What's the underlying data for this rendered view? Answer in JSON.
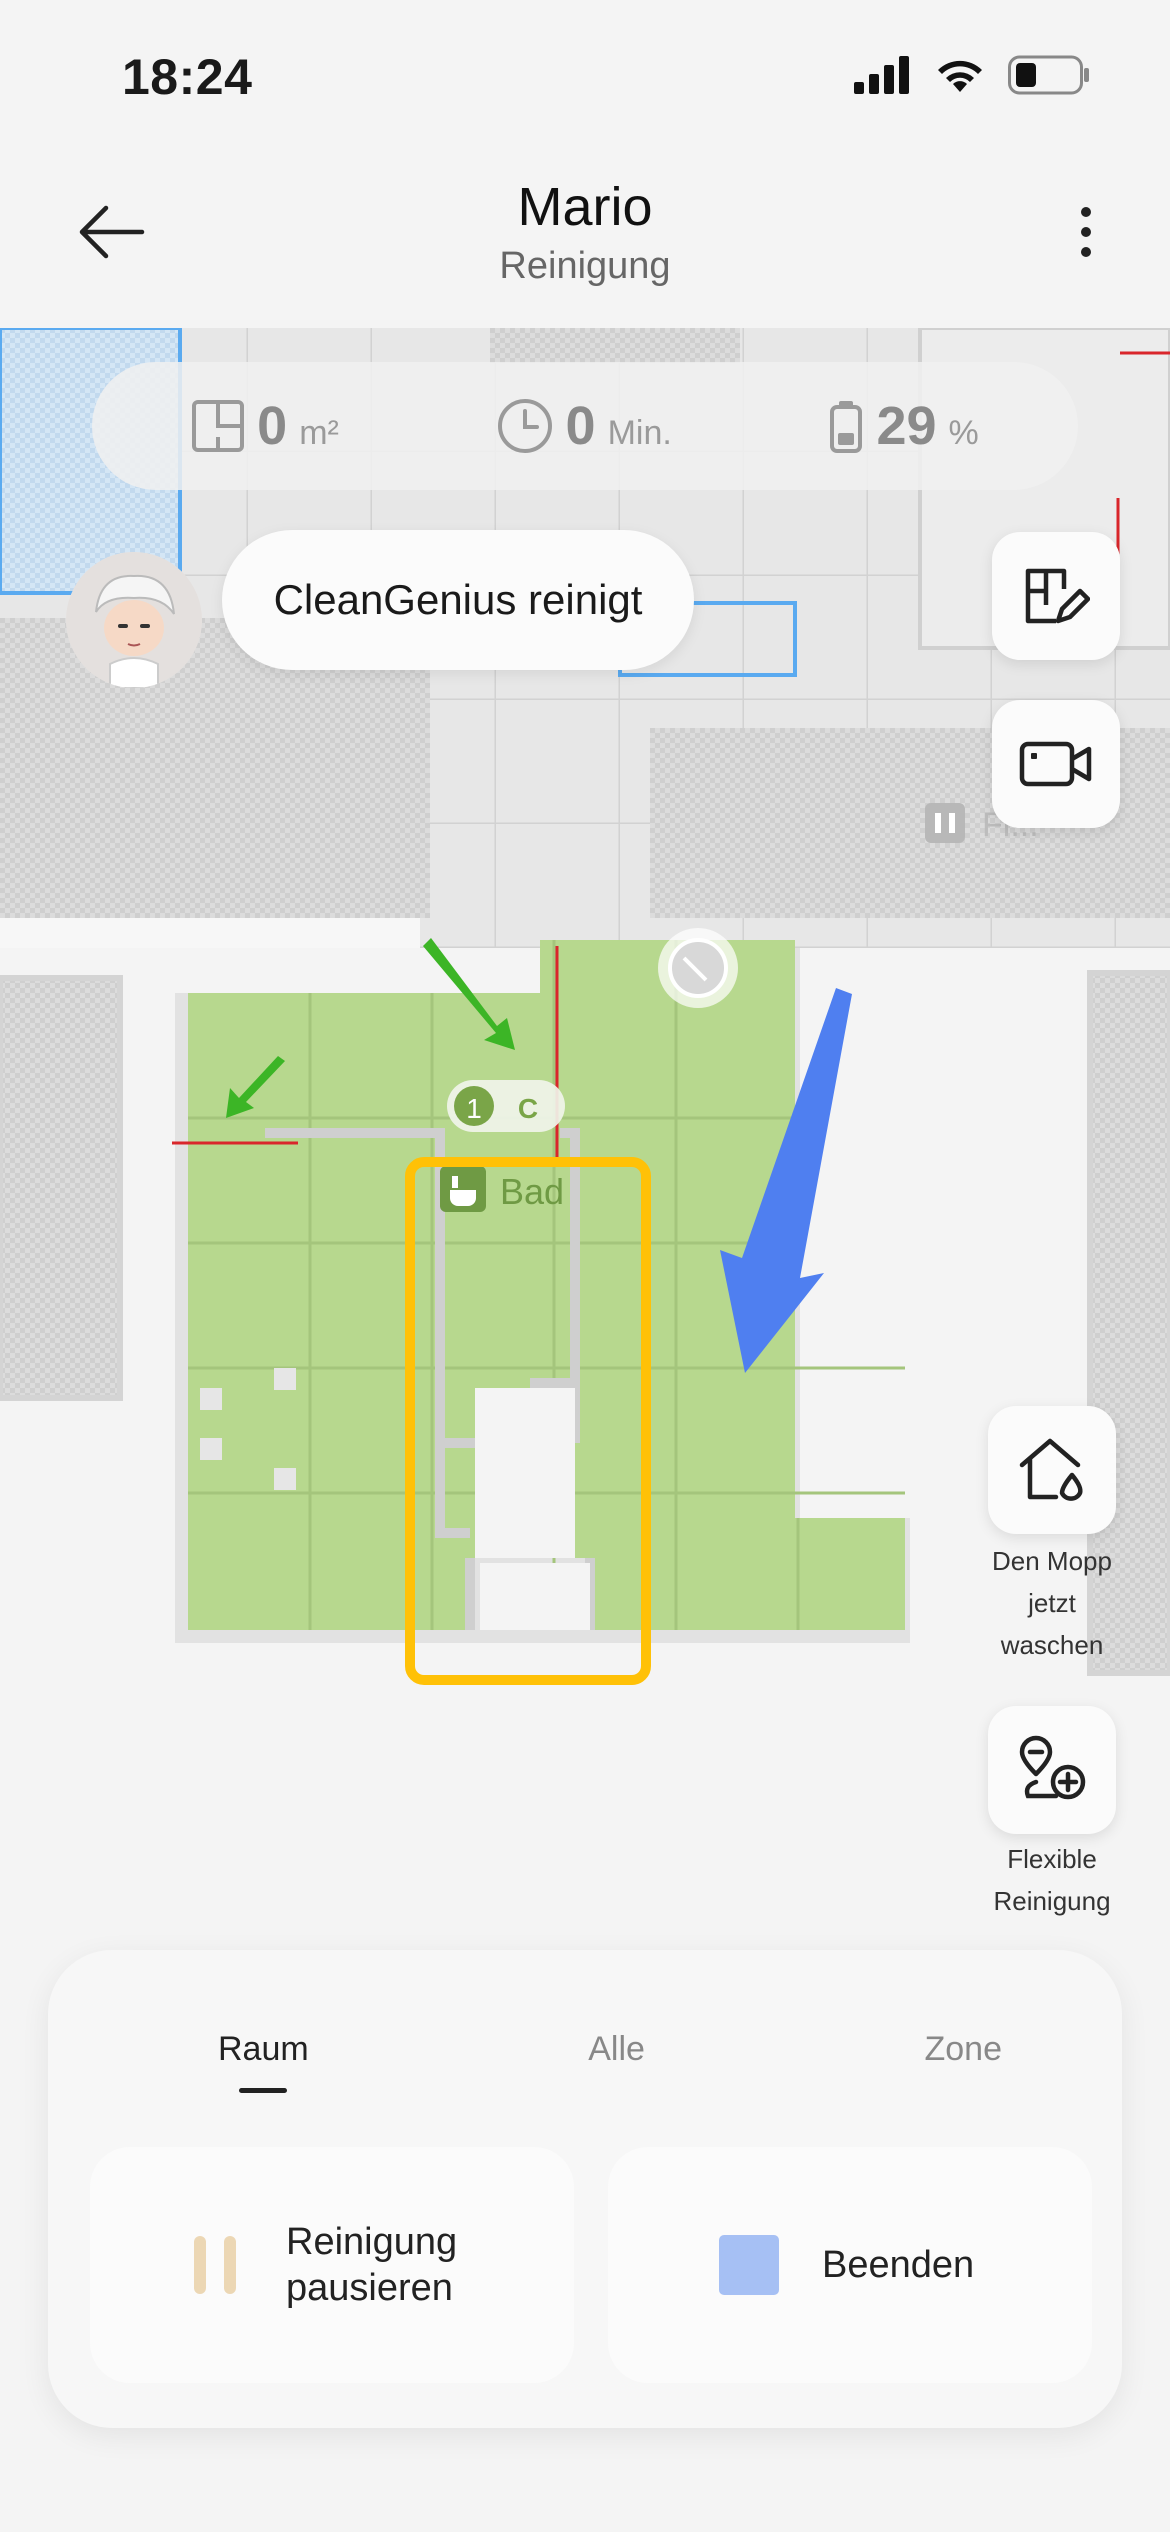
{
  "status_bar": {
    "time": "18:24"
  },
  "header": {
    "title": "Mario",
    "subtitle": "Reinigung"
  },
  "stats": {
    "area_value": "0",
    "area_unit": "m²",
    "time_value": "0",
    "time_unit": "Min.",
    "battery_value": "29",
    "battery_unit": "%"
  },
  "bubble": {
    "text": "CleanGenius reinigt"
  },
  "map": {
    "room_label": "Bad",
    "room_order": "1",
    "room_mode": "C",
    "faded_room_label": "Fl..."
  },
  "side_actions": {
    "mop_wash_label_lines": [
      "Den Mopp",
      "jetzt",
      "waschen"
    ],
    "flexible_label_lines": [
      "Flexible",
      "Reinigung"
    ]
  },
  "tabs": [
    {
      "label": "Raum",
      "active": true
    },
    {
      "label": "Alle",
      "active": false
    },
    {
      "label": "Zone",
      "active": false
    }
  ],
  "actions": {
    "pause_label_lines": [
      "Reinigung",
      "pausieren"
    ],
    "stop_label": "Beenden"
  },
  "colors": {
    "room_green": "#b7d88e",
    "highlight_yellow": "#ffc107",
    "arrow_blue": "#4f7ff0",
    "arrow_green": "#3cb526"
  }
}
